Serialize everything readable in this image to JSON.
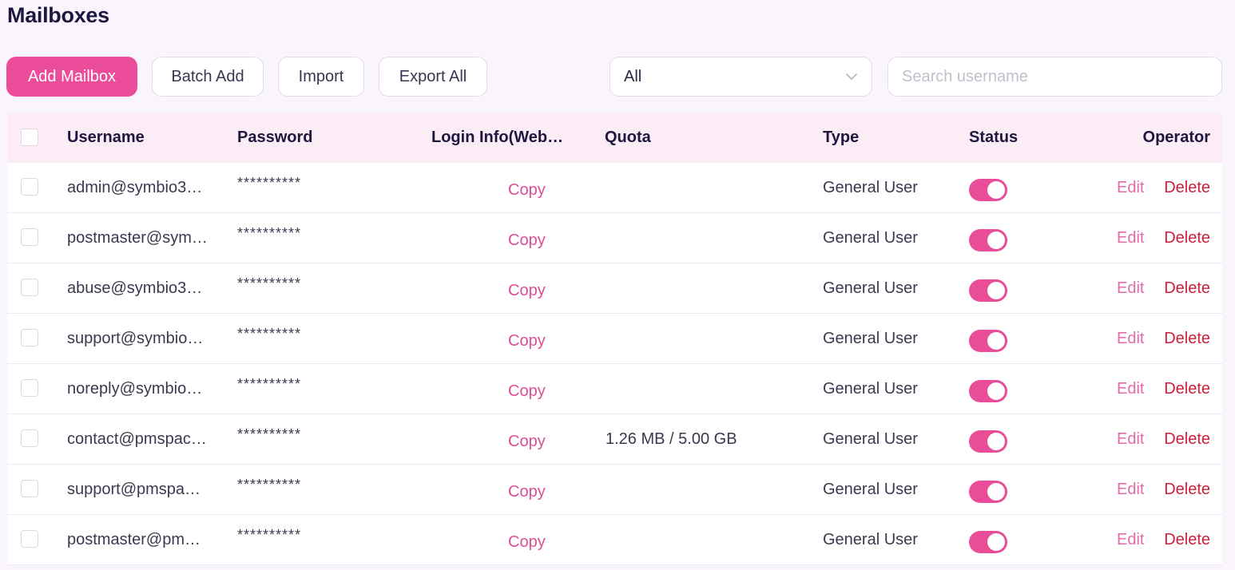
{
  "page_title": "Mailboxes",
  "toolbar": {
    "add_label": "Add Mailbox",
    "batch_label": "Batch Add",
    "import_label": "Import",
    "export_label": "Export All",
    "filter_value": "All",
    "search_placeholder": "Search username"
  },
  "colors": {
    "accent": "#ec4d9a",
    "delete": "#cc1f3a",
    "header_bg": "#fcecf6"
  },
  "columns": {
    "username": "Username",
    "password": "Password",
    "login_info": "Login Info(Web…",
    "quota": "Quota",
    "type": "Type",
    "status": "Status",
    "operator": "Operator"
  },
  "rows": [
    {
      "username": "admin@symbio3…",
      "password": "**********",
      "copy": "Copy",
      "quota": "",
      "type": "General User",
      "status": true,
      "edit": "Edit",
      "delete": "Delete"
    },
    {
      "username": "postmaster@sym…",
      "password": "**********",
      "copy": "Copy",
      "quota": "",
      "type": "General User",
      "status": true,
      "edit": "Edit",
      "delete": "Delete"
    },
    {
      "username": "abuse@symbio3…",
      "password": "**********",
      "copy": "Copy",
      "quota": "",
      "type": "General User",
      "status": true,
      "edit": "Edit",
      "delete": "Delete"
    },
    {
      "username": "support@symbio…",
      "password": "**********",
      "copy": "Copy",
      "quota": "",
      "type": "General User",
      "status": true,
      "edit": "Edit",
      "delete": "Delete"
    },
    {
      "username": "noreply@symbio…",
      "password": "**********",
      "copy": "Copy",
      "quota": "",
      "type": "General User",
      "status": true,
      "edit": "Edit",
      "delete": "Delete"
    },
    {
      "username": "contact@pmspac…",
      "password": "**********",
      "copy": "Copy",
      "quota": "1.26 MB / 5.00 GB",
      "type": "General User",
      "status": true,
      "edit": "Edit",
      "delete": "Delete"
    },
    {
      "username": "support@pmspa…",
      "password": "**********",
      "copy": "Copy",
      "quota": "",
      "type": "General User",
      "status": true,
      "edit": "Edit",
      "delete": "Delete"
    },
    {
      "username": "postmaster@pm…",
      "password": "**********",
      "copy": "Copy",
      "quota": "",
      "type": "General User",
      "status": true,
      "edit": "Edit",
      "delete": "Delete"
    }
  ]
}
